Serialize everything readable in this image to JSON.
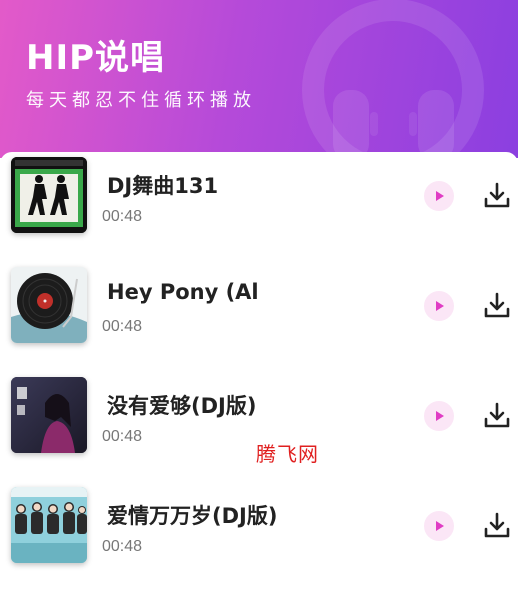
{
  "header": {
    "title": "HIP说唱",
    "subtitle": "每天都忍不住循环播放"
  },
  "songs": [
    {
      "title": "DJ舞曲131",
      "duration": "00:48",
      "cover_icon": "dancers-cover"
    },
    {
      "title": "Hey Pony (Al",
      "duration": "00:48",
      "cover_icon": "vinyl-record-cover"
    },
    {
      "title": "没有爱够(DJ版)",
      "duration": "00:48",
      "cover_icon": "portrait-cover"
    },
    {
      "title": "爱情万万岁(DJ版)",
      "duration": "00:48",
      "cover_icon": "band-photo-cover"
    }
  ],
  "watermark": "腾飞网",
  "colors": {
    "header_gradient_start": "#e35ac9",
    "header_gradient_end": "#8b3fe0",
    "play_accent": "#e03cc4",
    "play_bg": "#fbe6f6"
  }
}
